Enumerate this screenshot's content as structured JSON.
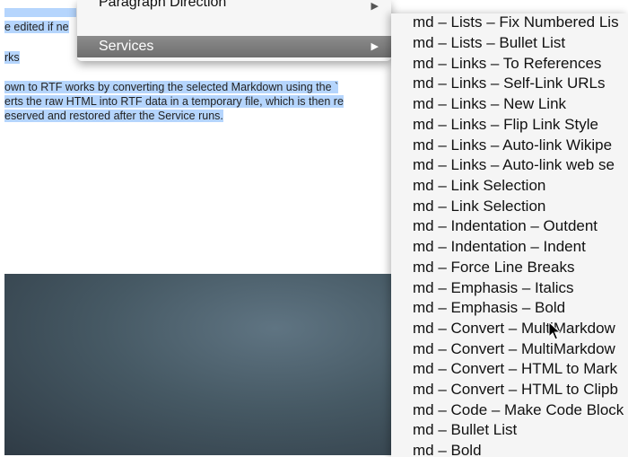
{
  "document": {
    "lines": [
      "e edited if ne",
      "rks",
      "own to RTF works by converting the selected Markdown using the `",
      "erts the raw HTML into RTF data in a temporary file, which is then re",
      "eserved and restored after the Service runs."
    ]
  },
  "context_menu": {
    "paragraph_direction": "Paragraph Direction",
    "services": "Services"
  },
  "services_menu": {
    "items": [
      "md – Lists – Fix Numbered Lis",
      "md – Lists – Bullet List",
      "md – Links – To References",
      "md – Links – Self-Link URLs",
      "md – Links – New Link",
      "md – Links – Flip Link Style",
      "md – Links – Auto-link Wikipe",
      "md – Links – Auto-link web se",
      "md – Link Selection",
      "md – Link Selection",
      "md – Indentation – Outdent",
      "md – Indentation – Indent",
      "md – Force Line Breaks",
      "md – Emphasis – Italics",
      "md – Emphasis – Bold",
      "md – Convert – MultiMarkdow",
      "md – Convert – MultiMarkdow",
      "md – Convert – HTML to Mark",
      "md – Convert – HTML to Clipb",
      "md – Code – Make Code Block",
      "md – Bullet List",
      "md – Bold"
    ]
  },
  "colors": {
    "selection": "#b5d5fd",
    "menu_highlight": "#7a7a7a",
    "desktop": "#465964"
  }
}
